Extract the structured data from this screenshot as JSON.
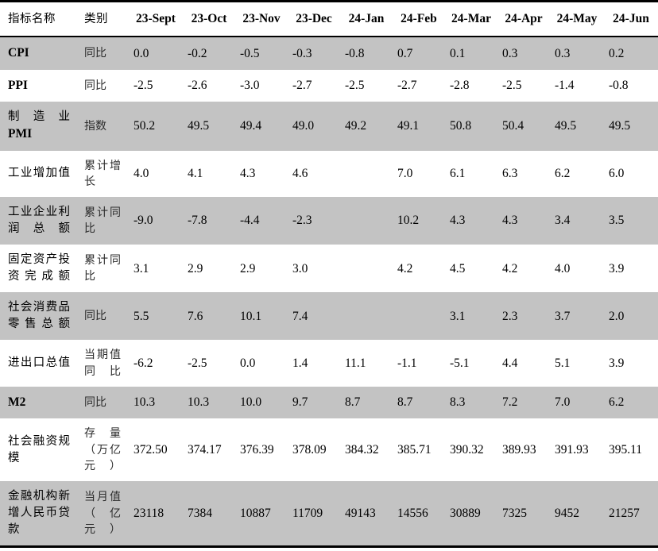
{
  "table": {
    "columns": {
      "name_header": "指标名称",
      "category_header": "类别",
      "months": [
        "23-Sept",
        "23-Oct",
        "23-Nov",
        "23-Dec",
        "24-Jan",
        "24-Feb",
        "24-Mar",
        "24-Apr",
        "24-May",
        "24-Jun"
      ]
    },
    "rows": [
      {
        "name": "CPI",
        "name_style": "bold",
        "category": "同比",
        "shaded": true,
        "values": [
          "0.0",
          "-0.2",
          "-0.5",
          "-0.3",
          "-0.8",
          "0.7",
          "0.1",
          "0.3",
          "0.3",
          "0.2"
        ]
      },
      {
        "name": "PPI",
        "name_style": "bold",
        "category": "同比",
        "shaded": false,
        "values": [
          "-2.5",
          "-2.6",
          "-3.0",
          "-2.7",
          "-2.5",
          "-2.7",
          "-2.8",
          "-2.5",
          "-1.4",
          "-0.8"
        ]
      },
      {
        "name": "制造业",
        "name_suffix": "PMI",
        "name_style": "mixed",
        "category": "指数",
        "shaded": true,
        "values": [
          "50.2",
          "49.5",
          "49.4",
          "49.0",
          "49.2",
          "49.1",
          "50.8",
          "50.4",
          "49.5",
          "49.5"
        ]
      },
      {
        "name": "工业增加值",
        "name_style": "cn",
        "category": "累计增长",
        "shaded": false,
        "values": [
          "4.0",
          "4.1",
          "4.3",
          "4.6",
          "",
          "7.0",
          "6.1",
          "6.3",
          "6.2",
          "6.0"
        ]
      },
      {
        "name": "工业企业利润总额",
        "name_style": "cn",
        "category": "累计同比",
        "shaded": true,
        "values": [
          "-9.0",
          "-7.8",
          "-4.4",
          "-2.3",
          "",
          "10.2",
          "4.3",
          "4.3",
          "3.4",
          "3.5"
        ]
      },
      {
        "name": "固定资产投资完成额",
        "name_style": "cn",
        "category": "累计同比",
        "shaded": false,
        "values": [
          "3.1",
          "2.9",
          "2.9",
          "3.0",
          "",
          "4.2",
          "4.5",
          "4.2",
          "4.0",
          "3.9"
        ]
      },
      {
        "name": "社会消费品零售总额",
        "name_style": "cn",
        "category": "同比",
        "shaded": true,
        "values": [
          "5.5",
          "7.6",
          "10.1",
          "7.4",
          "",
          "",
          "3.1",
          "2.3",
          "3.7",
          "2.0"
        ]
      },
      {
        "name": "进出口总值",
        "name_style": "cn",
        "category": "当期值同比",
        "shaded": false,
        "values": [
          "-6.2",
          "-2.5",
          "0.0",
          "1.4",
          "11.1",
          "-1.1",
          "-5.1",
          "4.4",
          "5.1",
          "3.9"
        ]
      },
      {
        "name": "M2",
        "name_style": "bold",
        "category": "同比",
        "shaded": true,
        "values": [
          "10.3",
          "10.3",
          "10.0",
          "9.7",
          "8.7",
          "8.7",
          "8.3",
          "7.2",
          "7.0",
          "6.2"
        ]
      },
      {
        "name": "社会融资规模",
        "name_style": "cn",
        "category": "存量（万亿元）",
        "shaded": false,
        "values": [
          "372.50",
          "374.17",
          "376.39",
          "378.09",
          "384.32",
          "385.71",
          "390.32",
          "389.93",
          "391.93",
          "395.11"
        ]
      },
      {
        "name": "金融机构新增人民币贷款",
        "name_style": "cn",
        "category": "当月值（亿元）",
        "shaded": true,
        "values": [
          "23118",
          "7384",
          "10887",
          "11709",
          "49143",
          "14556",
          "30889",
          "7325",
          "9452",
          "21257"
        ]
      }
    ]
  },
  "style": {
    "shaded_row_color": "#c3c3c3",
    "plain_row_color": "#ffffff",
    "rule_color": "#000000",
    "text_color": "#000000"
  }
}
